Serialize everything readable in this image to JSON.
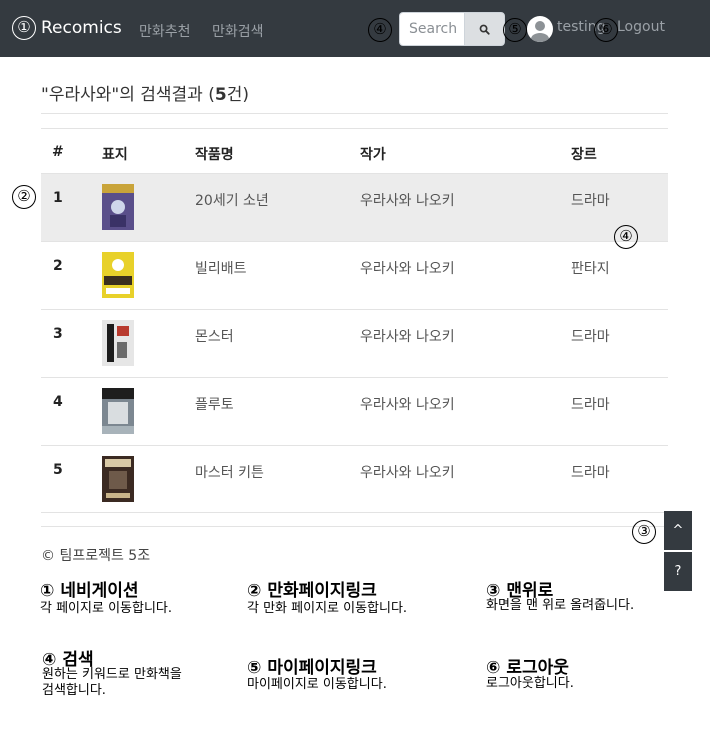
{
  "nav": {
    "brand": "Recomics",
    "links": [
      "만화추천",
      "만화검색"
    ],
    "search_placeholder": "Search",
    "user": "testing",
    "logout": "Logout"
  },
  "markers": [
    "①",
    "②",
    "③",
    "④",
    "⑤",
    "⑥"
  ],
  "results": {
    "heading_pre": "\"우라사와\"의 검색결과 (",
    "count": "5",
    "heading_post": "건)",
    "columns": [
      "#",
      "표지",
      "작품명",
      "작가",
      "장르"
    ],
    "rows": [
      {
        "num": "1",
        "title": "20세기 소년",
        "author": "우라사와 나오키",
        "genre": "드라마",
        "cover_color": "#5a4f8a"
      },
      {
        "num": "2",
        "title": "빌리배트",
        "author": "우라사와 나오키",
        "genre": "판타지",
        "cover_color": "#e8d12a"
      },
      {
        "num": "3",
        "title": "몬스터",
        "author": "우라사와 나오키",
        "genre": "드라마",
        "cover_color": "#e6e6e6"
      },
      {
        "num": "4",
        "title": "플루토",
        "author": "우라사와 나오키",
        "genre": "드라마",
        "cover_color": "#7c8791"
      },
      {
        "num": "5",
        "title": "마스터 키튼",
        "author": "우라사와 나오키",
        "genre": "드라마",
        "cover_color": "#3b2a22"
      }
    ]
  },
  "footer": {
    "copyright": "© 팀프로젝트 5조"
  },
  "float_buttons": {
    "top": "^",
    "help": "?"
  },
  "legend": [
    {
      "marker": "①",
      "title": "네비게이션",
      "desc": [
        "각 페이지로 이동합니다."
      ]
    },
    {
      "marker": "②",
      "title": "만화페이지링크",
      "desc": [
        "각 만화 페이지로 이동합니다."
      ]
    },
    {
      "marker": "③",
      "title": "맨위로",
      "desc": [
        "화면을 맨 위로 올려줍니다."
      ]
    },
    {
      "marker": "④",
      "title": "검색",
      "desc": [
        "원하는 키워드로 만화책을",
        "검색합니다."
      ]
    },
    {
      "marker": "⑤",
      "title": "마이페이지링크",
      "desc": [
        "마이페이지로 이동합니다."
      ]
    },
    {
      "marker": "⑥",
      "title": "로그아웃",
      "desc": [
        "로그아웃합니다."
      ]
    }
  ]
}
